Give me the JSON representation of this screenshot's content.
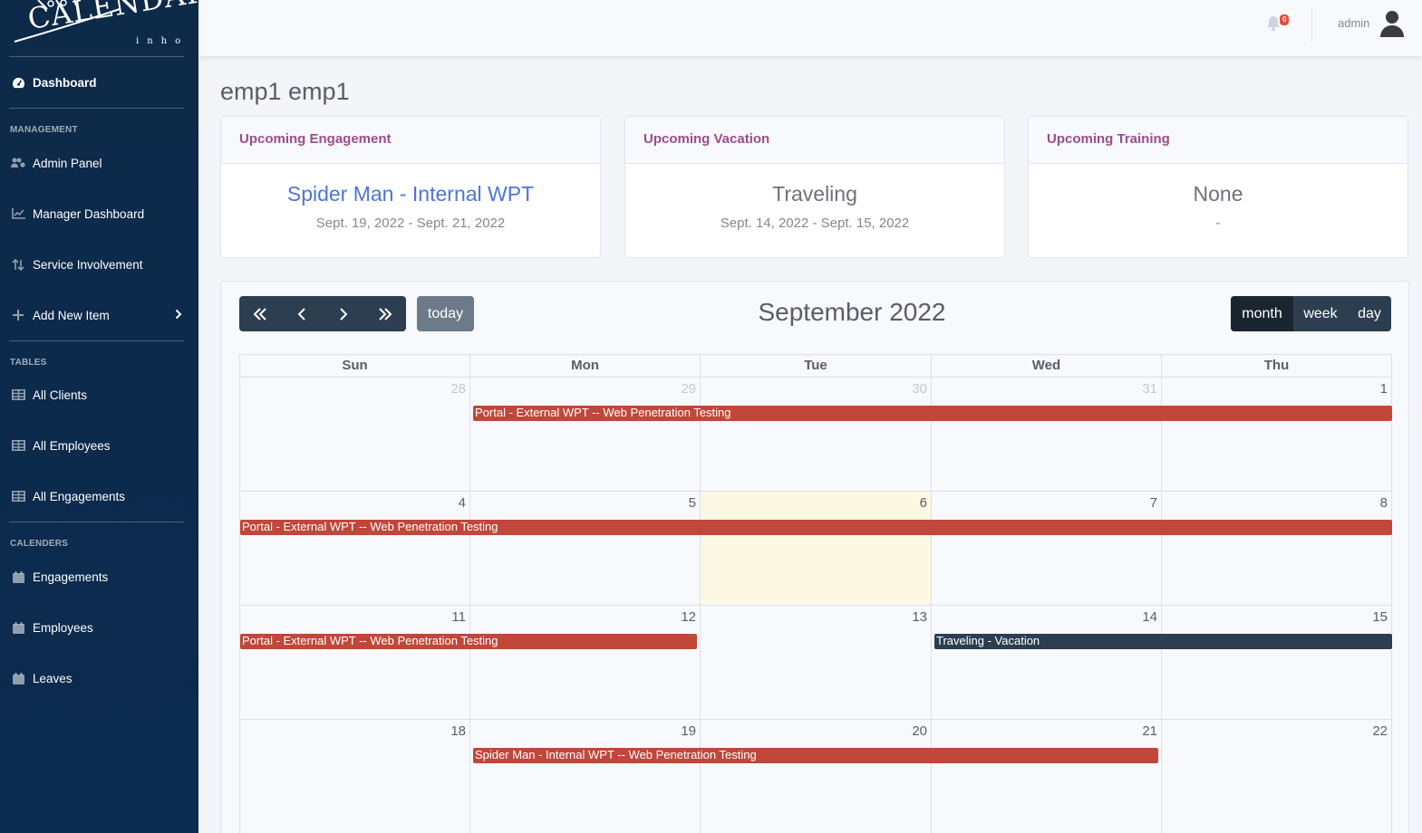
{
  "brand": {
    "name": "CALENDAR",
    "sub": "inho"
  },
  "sidebar": {
    "dashboard": "Dashboard",
    "sections": {
      "management": "MANAGEMENT",
      "tables": "TABLES",
      "calenders": "CALENDERS"
    },
    "items": [
      {
        "label": "Admin Panel",
        "icon": "users-cog-icon"
      },
      {
        "label": "Manager Dashboard",
        "icon": "chart-line-icon"
      },
      {
        "label": "Service Involvement",
        "icon": "sort-icon"
      },
      {
        "label": "Add New Item",
        "icon": "plus-icon"
      },
      {
        "label": "All Clients",
        "icon": "table-icon"
      },
      {
        "label": "All Employees",
        "icon": "table-icon"
      },
      {
        "label": "All Engagements",
        "icon": "table-icon"
      },
      {
        "label": "Engagements",
        "icon": "calendar-icon"
      },
      {
        "label": "Employees",
        "icon": "calendar-icon"
      },
      {
        "label": "Leaves",
        "icon": "calendar-icon"
      }
    ]
  },
  "topbar": {
    "notifications": "0",
    "user": "admin"
  },
  "page": {
    "title": "emp1 emp1"
  },
  "cards": [
    {
      "header": "Upcoming Engagement",
      "title": "Spider Man - Internal WPT",
      "dates": "Sept. 19, 2022 - Sept. 21, 2022"
    },
    {
      "header": "Upcoming Vacation",
      "title": "Traveling",
      "dates": "Sept. 14, 2022 - Sept. 15, 2022"
    },
    {
      "header": "Upcoming Training",
      "title": "None",
      "dates": "-"
    }
  ],
  "calendar": {
    "title": "September 2022",
    "today_label": "today",
    "views": [
      "month",
      "week",
      "day"
    ],
    "active_view": "month",
    "weekdays": [
      "Sun",
      "Mon",
      "Tue",
      "Wed",
      "Thu"
    ],
    "weeks": [
      {
        "days": [
          "28",
          "29",
          "30",
          "31",
          "1"
        ],
        "other": [
          true,
          true,
          true,
          true,
          false
        ]
      },
      {
        "days": [
          "4",
          "5",
          "6",
          "7",
          "8"
        ],
        "other": [
          false,
          false,
          false,
          false,
          false
        ],
        "today_index": 2
      },
      {
        "days": [
          "11",
          "12",
          "13",
          "14",
          "15"
        ],
        "other": [
          false,
          false,
          false,
          false,
          false
        ]
      },
      {
        "days": [
          "18",
          "19",
          "20",
          "21",
          "22"
        ],
        "other": [
          false,
          false,
          false,
          false,
          false
        ]
      }
    ],
    "events": [
      {
        "label": "Portal - External WPT -- Web Penetration Testing",
        "week": 0,
        "start": 1,
        "end": 4,
        "color": "#c0473a"
      },
      {
        "label": "Portal - External WPT -- Web Penetration Testing",
        "week": 1,
        "start": 0,
        "end": 4,
        "color": "#c0473a"
      },
      {
        "label": "Portal - External WPT -- Web Penetration Testing",
        "week": 2,
        "start": 0,
        "end": 1,
        "color": "#c0473a"
      },
      {
        "label": "Traveling - Vacation",
        "week": 2,
        "start": 3,
        "end": 4,
        "color": "#2c3e50"
      },
      {
        "label": "Spider Man - Internal WPT -- Web Penetration Testing",
        "week": 3,
        "start": 1,
        "end": 3,
        "color": "#c0473a"
      }
    ]
  }
}
